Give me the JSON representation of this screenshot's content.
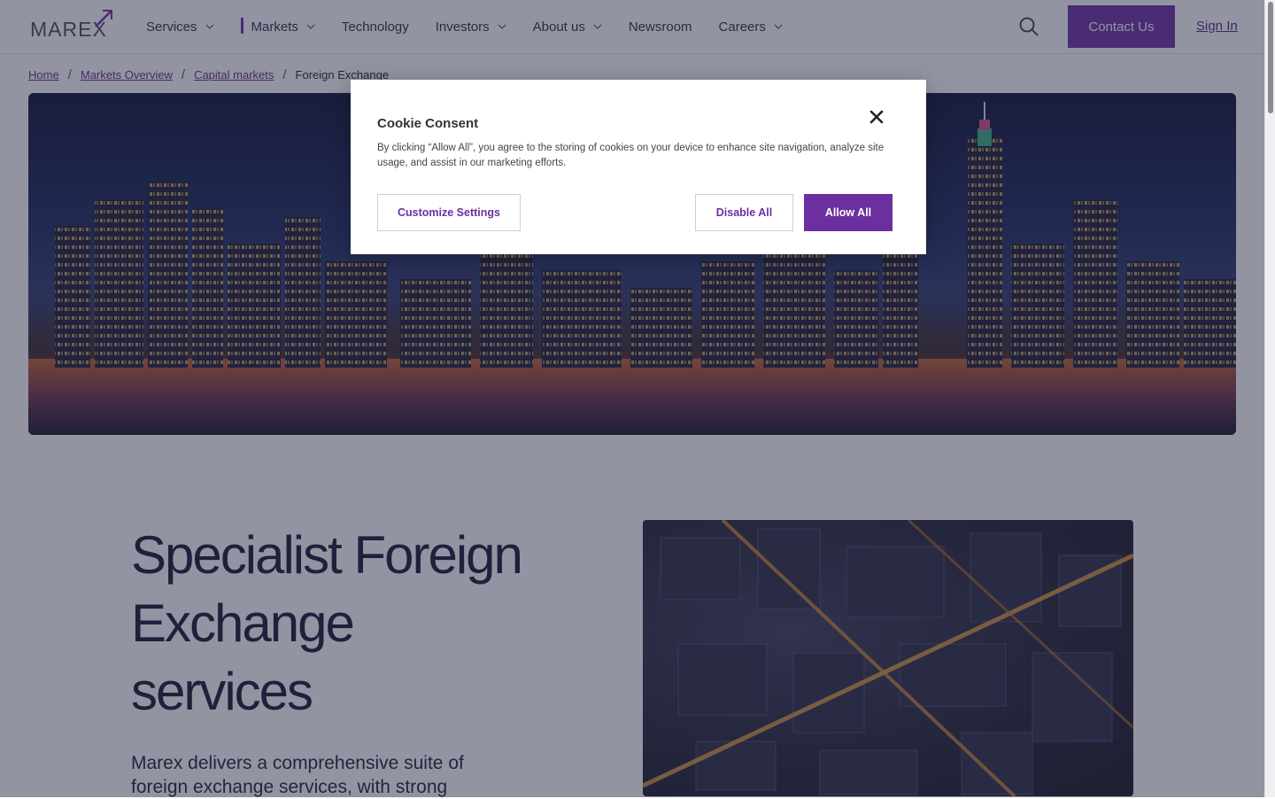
{
  "header": {
    "logo_text": "MAREX",
    "nav": [
      {
        "label": "Services",
        "has_dropdown": true
      },
      {
        "label": "Markets",
        "has_dropdown": true,
        "active": true
      },
      {
        "label": "Technology",
        "has_dropdown": false
      },
      {
        "label": "Investors",
        "has_dropdown": true
      },
      {
        "label": "About us",
        "has_dropdown": true
      },
      {
        "label": "Newsroom",
        "has_dropdown": false
      },
      {
        "label": "Careers",
        "has_dropdown": true
      }
    ],
    "contact_label": "Contact Us",
    "signin_label": "Sign In"
  },
  "breadcrumb": {
    "items": [
      "Home",
      "Markets Overview",
      "Capital markets"
    ],
    "current": "Foreign Exchange"
  },
  "main": {
    "headline": "Specialist Foreign Exchange services",
    "lede": "Marex delivers a comprehensive suite of foreign exchange services, with strong"
  },
  "cookie_modal": {
    "title": "Cookie Consent",
    "body": "By clicking “Allow All”, you agree to the storing of cookies on your device to enhance site navigation, analyze site usage, and assist in our marketing efforts.",
    "customize_label": "Customize Settings",
    "disable_label": "Disable All",
    "allow_label": "Allow All"
  },
  "colors": {
    "brand_purple": "#6b2fa0",
    "overlay": "rgba(40,42,70,0.5)",
    "text_dark": "#161630"
  }
}
